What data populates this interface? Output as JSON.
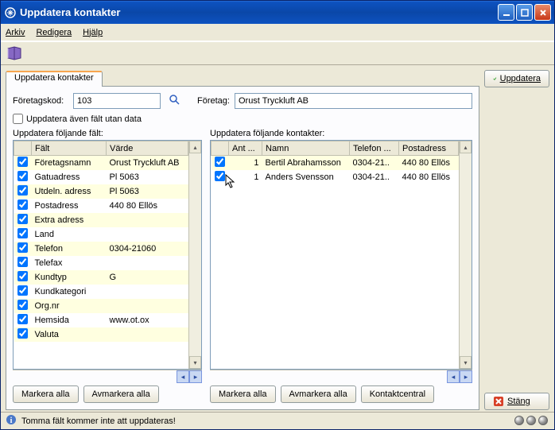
{
  "window": {
    "title": "Uppdatera kontakter"
  },
  "menu": {
    "arkiv": "Arkiv",
    "redigera": "Redigera",
    "hjalp": "Hjälp"
  },
  "tab": {
    "label": "Uppdatera kontakter"
  },
  "form": {
    "foretagskod_label": "Företagskod:",
    "foretagskod_value": "103",
    "foretag_label": "Företag:",
    "foretag_value": "Orust Tryckluft AB",
    "uppdatera_aven": "Uppdatera även fält utan data"
  },
  "left": {
    "heading": "Uppdatera följande fält:",
    "col_falt": "Fält",
    "col_varde": "Värde",
    "rows": [
      {
        "checked": true,
        "falt": "Företagsnamn",
        "varde": "Orust Tryckluft AB"
      },
      {
        "checked": true,
        "falt": "Gatuadress",
        "varde": "Pl 5063"
      },
      {
        "checked": true,
        "falt": "Utdeln. adress",
        "varde": "Pl 5063"
      },
      {
        "checked": true,
        "falt": "Postadress",
        "varde": "440 80 Ellös"
      },
      {
        "checked": true,
        "falt": "Extra adress",
        "varde": ""
      },
      {
        "checked": true,
        "falt": "Land",
        "varde": ""
      },
      {
        "checked": true,
        "falt": "Telefon",
        "varde": "0304-21060"
      },
      {
        "checked": true,
        "falt": "Telefax",
        "varde": ""
      },
      {
        "checked": true,
        "falt": "Kundtyp",
        "varde": "G"
      },
      {
        "checked": true,
        "falt": "Kundkategori",
        "varde": ""
      },
      {
        "checked": true,
        "falt": "Org.nr",
        "varde": ""
      },
      {
        "checked": true,
        "falt": "Hemsida",
        "varde": "www.ot.ox"
      },
      {
        "checked": true,
        "falt": "Valuta",
        "varde": ""
      }
    ]
  },
  "right": {
    "heading": "Uppdatera följande kontakter:",
    "col_ant": "Ant ...",
    "col_namn": "Namn",
    "col_telefon": "Telefon ...",
    "col_post": "Postadress",
    "rows": [
      {
        "checked": true,
        "ant": "1",
        "namn": "Bertil Abrahamsson",
        "telefon": "0304-21..",
        "post": "440 80 Ellös"
      },
      {
        "checked": true,
        "ant": "1",
        "namn": "Anders Svensson",
        "telefon": "0304-21..",
        "post": "440 80 Ellös"
      }
    ]
  },
  "buttons": {
    "markera_alla": "Markera alla",
    "avmarkera_alla": "Avmarkera alla",
    "kontaktcentral": "Kontaktcentral",
    "uppdatera": "Uppdatera",
    "stang": "Stäng"
  },
  "status": {
    "text": "Tomma fält kommer inte att uppdateras!"
  }
}
